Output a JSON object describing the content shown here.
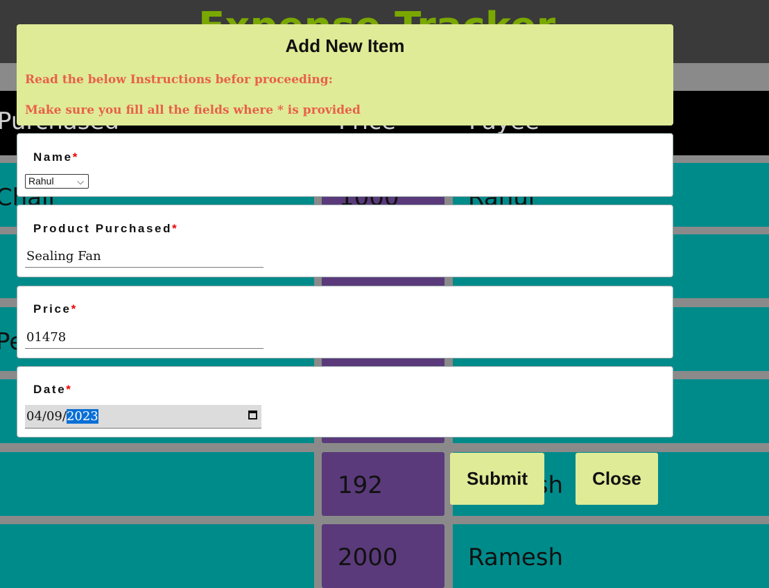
{
  "background": {
    "app_title": "Expense Tracker",
    "columns": [
      "Purchased",
      "Price",
      "Payee"
    ],
    "rows": [
      {
        "product": "Chair",
        "price": "1000",
        "payee": "Rahul"
      },
      {
        "product": "",
        "price": "",
        "payee": ""
      },
      {
        "product": "Pencils",
        "price": "",
        "payee": ""
      },
      {
        "product": "",
        "price": "",
        "payee": ""
      },
      {
        "product": "",
        "price": "192",
        "payee": "Ramesh"
      },
      {
        "product": "",
        "price": "2000",
        "payee": "Ramesh"
      }
    ]
  },
  "modal": {
    "title": "Add New Item",
    "instruction_1": "Read the below Instructions befor proceeding:",
    "instruction_2": "Make sure you fill all the fields where * is provided",
    "required_mark": "*",
    "fields": {
      "name": {
        "label": "Name",
        "value": "Rahul"
      },
      "product": {
        "label": "Product Purchased",
        "value": "Sealing Fan"
      },
      "price": {
        "label": "Price",
        "value": "01478"
      },
      "date": {
        "label": "Date",
        "value_prefix": "04/09/",
        "value_selected": "2023"
      }
    },
    "submit_label": "Submit",
    "close_label": "Close"
  },
  "colors": {
    "modal_header_bg": "#dfeb96",
    "instruction_text": "#e8604a",
    "table_cell": "#008b8b",
    "price_cell": "#5a3a7a",
    "app_title": "#7aa800"
  }
}
